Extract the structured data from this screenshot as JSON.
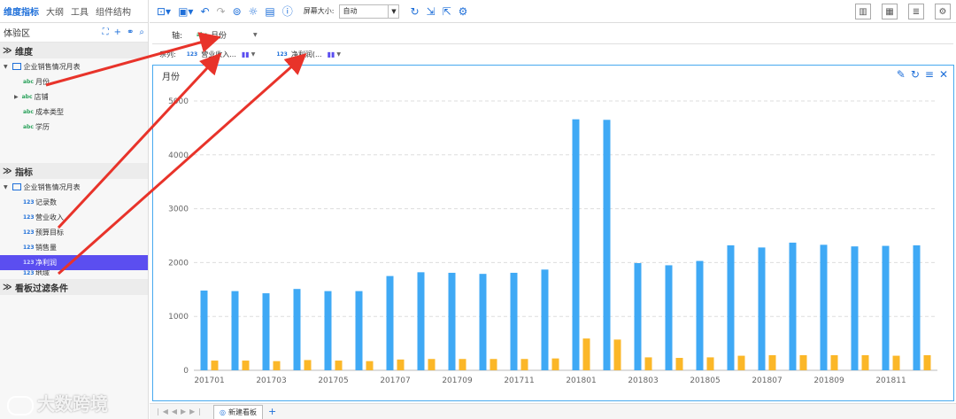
{
  "left_tabs": [
    "维度指标",
    "大纲",
    "工具",
    "组件结构"
  ],
  "area_label": "体验区",
  "dimension_section": "维度",
  "dimension_parent": "企业销售情况月表",
  "dimensions": [
    {
      "type": "abc",
      "label": "月份"
    },
    {
      "type": "abc",
      "label": "店铺"
    },
    {
      "type": "abc",
      "label": "成本类型"
    },
    {
      "type": "abc",
      "label": "学历"
    }
  ],
  "measure_section": "指标",
  "measure_parent": "企业销售情况月表",
  "measures": [
    {
      "type": "123",
      "label": "记录数"
    },
    {
      "type": "123",
      "label": "营业收入"
    },
    {
      "type": "123",
      "label": "预算目标"
    },
    {
      "type": "123",
      "label": "销售量"
    },
    {
      "type": "123",
      "label": "净利润"
    },
    {
      "type": "123",
      "label": "地域"
    }
  ],
  "filter_section": "看板过滤条件",
  "toolbar": {
    "screen_size_label": "屏幕大小:",
    "screen_size_value": "自动"
  },
  "axis_bar": {
    "label": "轴:",
    "field": "月份"
  },
  "series_bar": {
    "label": "系列:",
    "items": [
      "营业收入...",
      "净利润(..."
    ]
  },
  "panel": {
    "title": "月份"
  },
  "bottom": {
    "tab": "新建看板"
  },
  "watermark": "大数跨境",
  "colors": {
    "accent": "#1e6fd9",
    "series1": "#3fa9f5",
    "series2": "#fbb728",
    "selected": "#5b4ef0",
    "arrow": "#e8332a"
  },
  "chart_data": {
    "type": "bar",
    "categories": [
      "201701",
      "201702",
      "201703",
      "201704",
      "201705",
      "201706",
      "201707",
      "201708",
      "201709",
      "201710",
      "201711",
      "201712",
      "201801",
      "201802",
      "201803",
      "201804",
      "201805",
      "201806",
      "201807",
      "201808",
      "201809",
      "201810",
      "201811",
      "201812"
    ],
    "tick_labels": [
      "201701",
      "201703",
      "201705",
      "201707",
      "201709",
      "201711",
      "201801",
      "201803",
      "201805",
      "201807",
      "201809",
      "201811"
    ],
    "series": [
      {
        "name": "营业收入",
        "values": [
          1480,
          1470,
          1430,
          1510,
          1470,
          1470,
          1750,
          1820,
          1810,
          1790,
          1810,
          1870,
          4660,
          4650,
          1990,
          1950,
          2030,
          2320,
          2280,
          2370,
          2330,
          2300,
          2310,
          2320
        ]
      },
      {
        "name": "净利润",
        "values": [
          180,
          180,
          170,
          190,
          180,
          170,
          200,
          210,
          210,
          210,
          210,
          220,
          590,
          570,
          240,
          230,
          240,
          270,
          280,
          280,
          280,
          280,
          270,
          280
        ]
      }
    ],
    "yticks": [
      0,
      1000,
      2000,
      3000,
      4000,
      5000
    ],
    "ylim": [
      0,
      5000
    ],
    "grid": true
  }
}
